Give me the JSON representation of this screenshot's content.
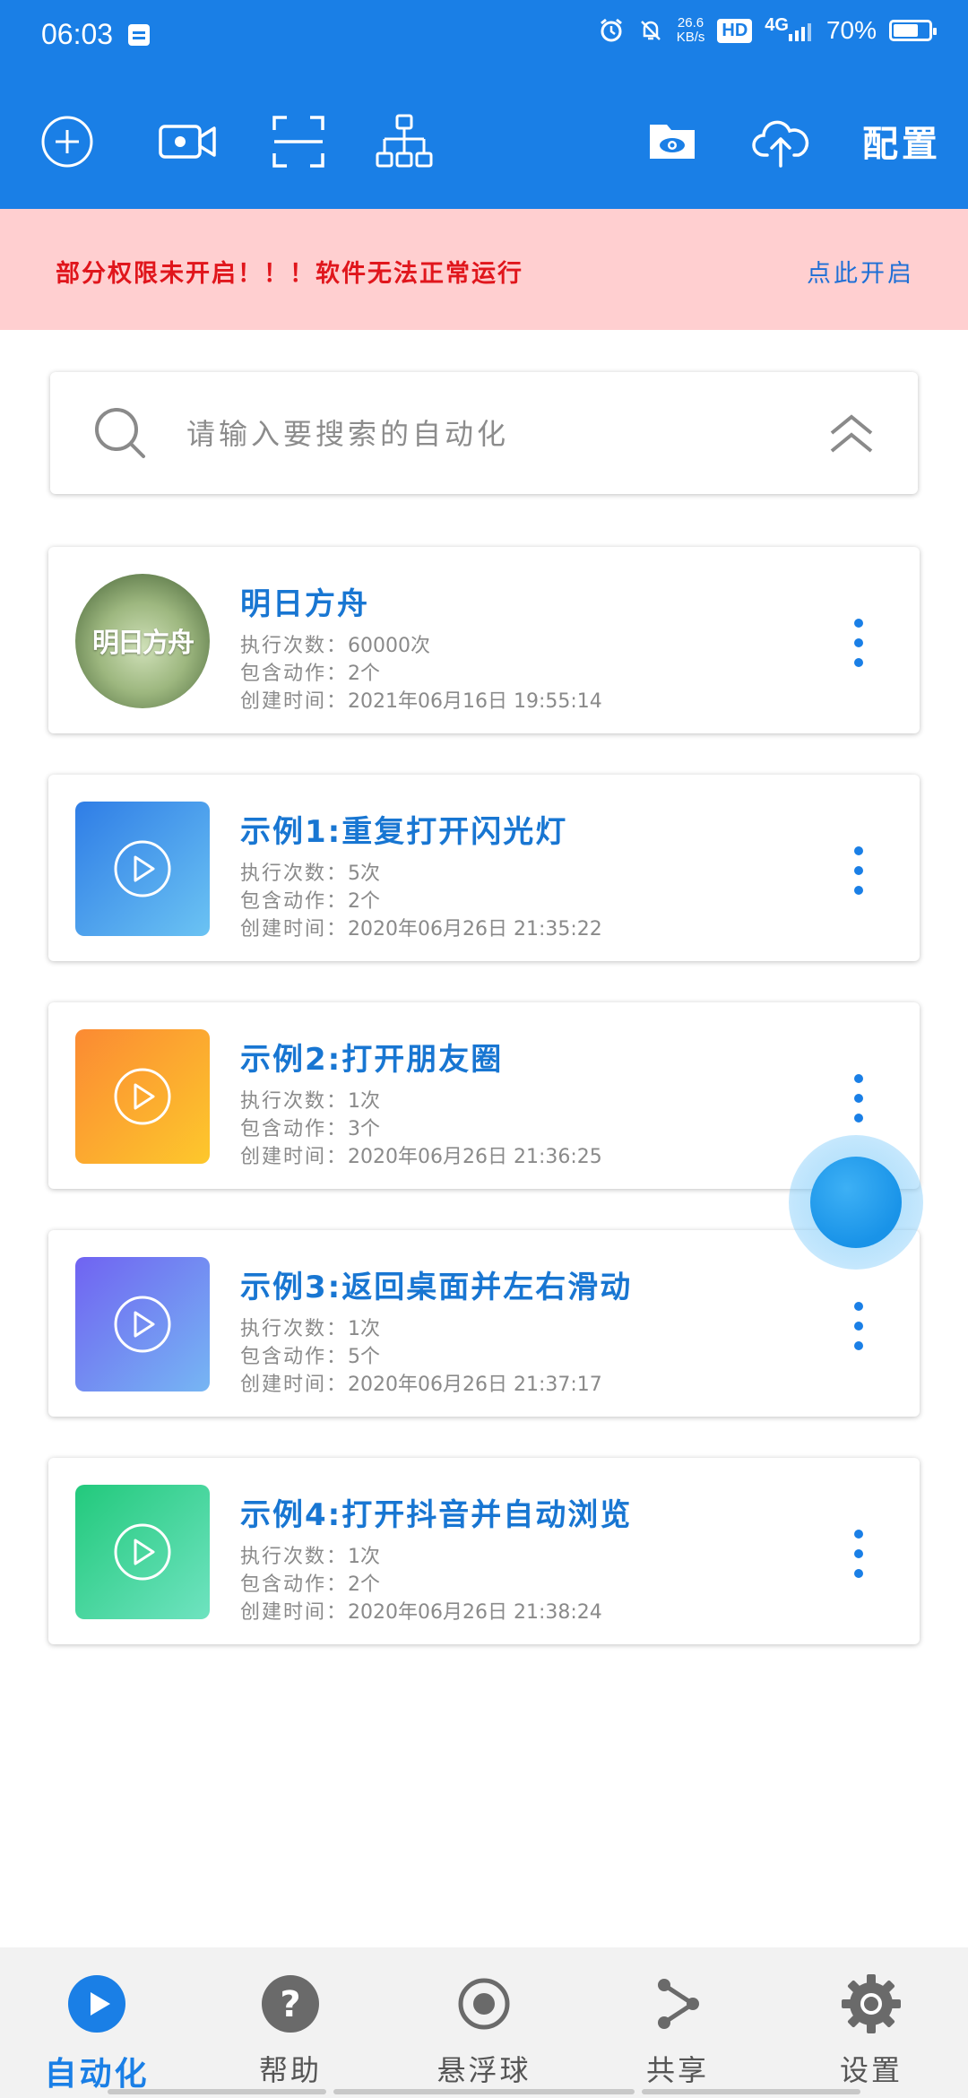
{
  "status_bar": {
    "time": "06:03",
    "speed": "26.6",
    "speed_unit": "KB/s",
    "hd": "HD",
    "network": "4G",
    "battery": "70%",
    "battery_level": 0.7
  },
  "toolbar": {
    "icons": [
      "add-icon",
      "record-video-icon",
      "scan-icon",
      "hierarchy-icon",
      "folder-view-icon",
      "cloud-upload-icon"
    ],
    "config_label": "配置"
  },
  "warning": {
    "text": "部分权限未开启！！！软件无法正常运行",
    "link": "点此开启"
  },
  "search": {
    "placeholder": "请输入要搜索的自动化"
  },
  "labels": {
    "exec_count": "执行次数：",
    "action_count": "包含动作：",
    "created": "创建时间："
  },
  "cards": [
    {
      "title": "明日方舟",
      "exec": "60000次",
      "actions": "2个",
      "created": "2021年06月16日 19:55:14",
      "thumb": "明日方舟"
    },
    {
      "title": "示例1:重复打开闪光灯",
      "exec": "5次",
      "actions": "2个",
      "created": "2020年06月26日 21:35:22"
    },
    {
      "title": "示例2:打开朋友圈",
      "exec": "1次",
      "actions": "3个",
      "created": "2020年06月26日 21:36:25"
    },
    {
      "title": "示例3:返回桌面并左右滑动",
      "exec": "1次",
      "actions": "5个",
      "created": "2020年06月26日 21:37:17"
    },
    {
      "title": "示例4:打开抖音并自动浏览",
      "exec": "1次",
      "actions": "2个",
      "created": "2020年06月26日 21:38:24"
    }
  ],
  "colors": {
    "primary": "#1a7fe6",
    "warning_bg": "#ffcfd0",
    "warning_text": "#e0161c",
    "card_title": "#1876d2"
  },
  "bottom_nav": [
    {
      "label": "自动化",
      "icon": "play-circle-icon",
      "active": true
    },
    {
      "label": "帮助",
      "icon": "help-icon",
      "active": false
    },
    {
      "label": "悬浮球",
      "icon": "floating-ball-icon",
      "active": false
    },
    {
      "label": "共享",
      "icon": "share-icon",
      "active": false
    },
    {
      "label": "设置",
      "icon": "gear-icon",
      "active": false
    }
  ]
}
